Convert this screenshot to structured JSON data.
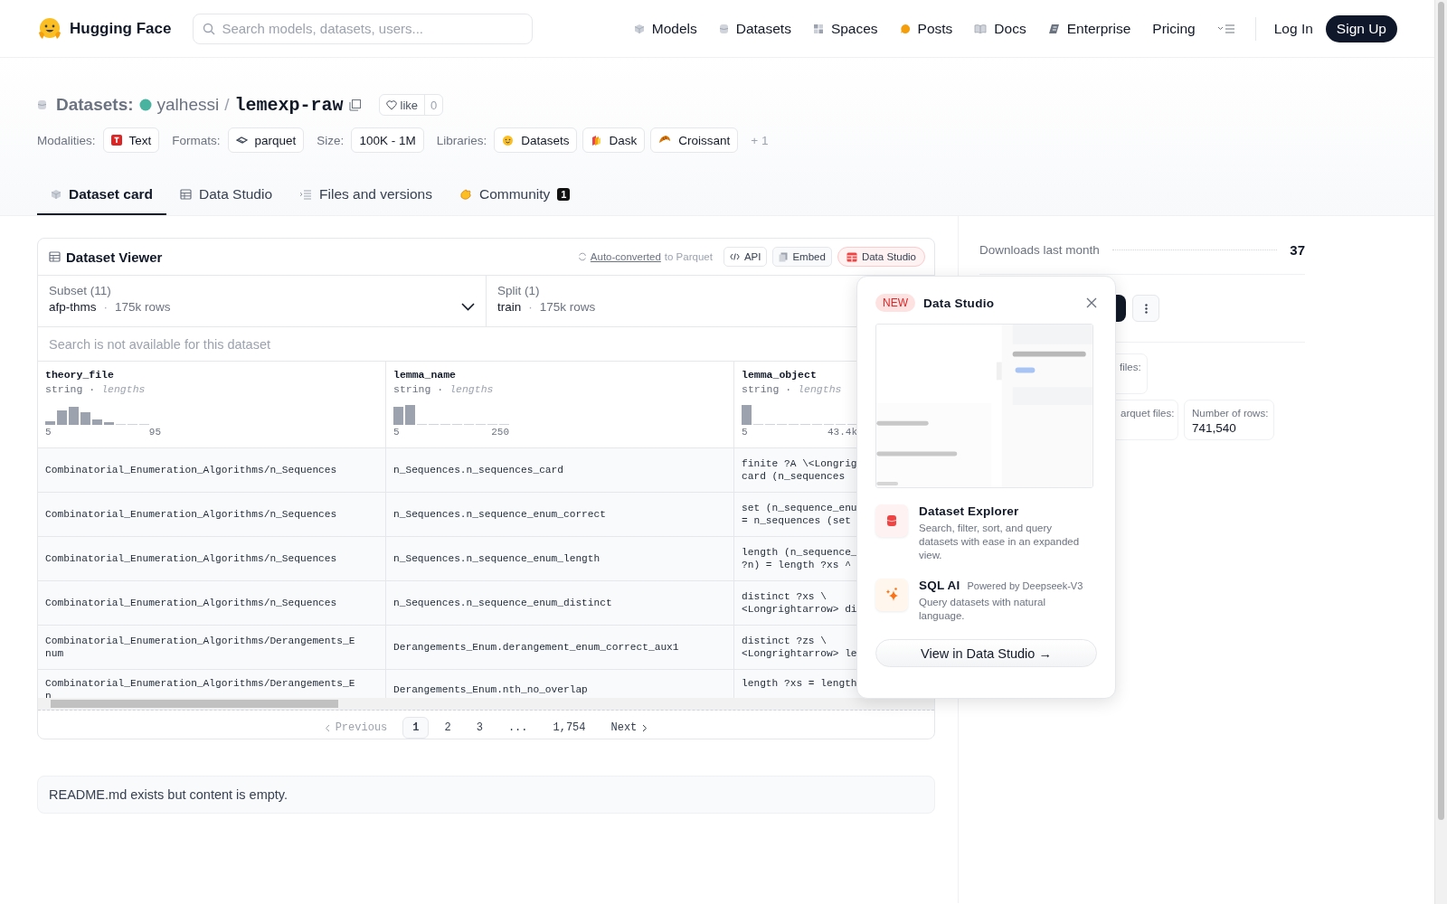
{
  "nav": {
    "brand": "Hugging Face",
    "search_placeholder": "Search models, datasets, users...",
    "links": [
      {
        "label": "Models"
      },
      {
        "label": "Datasets"
      },
      {
        "label": "Spaces"
      },
      {
        "label": "Posts"
      },
      {
        "label": "Docs"
      },
      {
        "label": "Enterprise"
      },
      {
        "label": "Pricing"
      }
    ],
    "login": "Log In",
    "signup": "Sign Up"
  },
  "repo": {
    "section": "Datasets:",
    "owner": "yalhessi",
    "separator": "/",
    "name": "lemexp-raw",
    "like_label": "like",
    "like_count": "0"
  },
  "tag_groups": [
    {
      "label": "Modalities:",
      "items": [
        {
          "text": "Text"
        }
      ]
    },
    {
      "label": "Formats:",
      "items": [
        {
          "text": "parquet"
        }
      ]
    },
    {
      "label": "Size:",
      "items": [
        {
          "text": "100K - 1M"
        }
      ]
    },
    {
      "label": "Libraries:",
      "items": [
        {
          "text": "Datasets"
        },
        {
          "text": "Dask"
        },
        {
          "text": "Croissant"
        }
      ]
    }
  ],
  "tags_more": "+ 1",
  "tabs": [
    {
      "label": "Dataset card",
      "selected": true
    },
    {
      "label": "Data Studio",
      "selected": false
    },
    {
      "label": "Files and versions",
      "selected": false
    },
    {
      "label": "Community",
      "selected": false,
      "badge": "1"
    }
  ],
  "viewer": {
    "title": "Dataset Viewer",
    "auto_link": "Auto-converted",
    "auto_rest": "to Parquet",
    "buttons": [
      {
        "label": "API",
        "kind": "api"
      },
      {
        "label": "Embed",
        "kind": "embed"
      },
      {
        "label": "Data Studio",
        "kind": "studio"
      }
    ],
    "subset": {
      "label": "Subset (11)",
      "value": "afp-thms",
      "sep": "·",
      "rows": "175k rows"
    },
    "split": {
      "label": "Split (1)",
      "value": "train",
      "sep": "·",
      "rows": "175k rows"
    },
    "search_placeholder": "Search is not available for this dataset",
    "columns": [
      {
        "name": "theory_file",
        "type": "string",
        "sep": "·",
        "stat": "lengths",
        "min": "5",
        "max": "95"
      },
      {
        "name": "lemma_name",
        "type": "string",
        "sep": "·",
        "stat": "lengths",
        "min": "5",
        "max": "250"
      },
      {
        "name": "lemma_object",
        "type": "string",
        "sep": "·",
        "stat": "lengths",
        "min": "5",
        "max": "43.4k"
      }
    ],
    "rows": [
      [
        "Combinatorial_Enumeration_Algorithms/n_Sequences",
        "n_Sequences.n_sequences_card",
        "finite ?A \\<Longrig\ncard (n_sequences"
      ],
      [
        "Combinatorial_Enumeration_Algorithms/n_Sequences",
        "n_Sequences.n_sequence_enum_correct",
        "set (n_sequence_enu\n= n_sequences (set"
      ],
      [
        "Combinatorial_Enumeration_Algorithms/n_Sequences",
        "n_Sequences.n_sequence_enum_length",
        "length (n_sequence_\n?n) = length ?xs ^"
      ],
      [
        "Combinatorial_Enumeration_Algorithms/n_Sequences",
        "n_Sequences.n_sequence_enum_distinct",
        "distinct ?xs \\\n<Longrightarrow> di"
      ],
      [
        "Combinatorial_Enumeration_Algorithms/Derangements_Enum",
        "Derangements_Enum.derangement_enum_correct_aux1",
        "distinct ?zs \\\n<Longrightarrow> le"
      ],
      [
        "Combinatorial_Enumeration_Algorithms/Derangements_En",
        "Derangements_Enum.nth_no_overlap",
        "length ?xs = length"
      ]
    ],
    "previous": {
      "label": "Previous",
      "disabled": true
    },
    "pages": [
      {
        "label": "1",
        "selected": true
      },
      {
        "label": "2",
        "selected": false
      },
      {
        "label": "3",
        "selected": false
      },
      {
        "label": "...",
        "selected": false
      },
      {
        "label": "1,754",
        "selected": false
      }
    ],
    "next": {
      "label": "Next",
      "disabled": false
    }
  },
  "popup": {
    "badge": "NEW",
    "title": "Data Studio",
    "features": [
      {
        "title": "Dataset Explorer",
        "description": "Search, filter, sort, and query datasets with ease in an expanded view."
      },
      {
        "title": "SQL AI",
        "note": "Powered by Deepseek-V3",
        "description": "Query datasets with natural language."
      }
    ],
    "button": "View in Data Studio →"
  },
  "sidebar": {
    "downloads_label": "Downloads last month",
    "downloads_value": "37",
    "stats": [
      {
        "label": "files:"
      },
      {
        "label": "arquet files:"
      },
      {
        "label": "Number of rows:",
        "value": "741,540"
      }
    ]
  },
  "readme": "README.md exists but content is empty."
}
